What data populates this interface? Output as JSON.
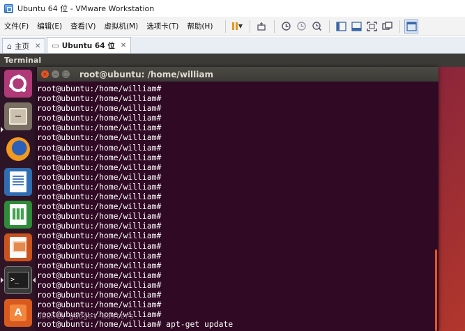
{
  "window": {
    "title": "Ubuntu 64 位 - VMware Workstation"
  },
  "menubar": {
    "items": [
      "文件(F)",
      "编辑(E)",
      "查看(V)",
      "虚拟机(M)",
      "选项卡(T)",
      "帮助(H)"
    ]
  },
  "toolbar": {
    "icons": [
      "pause-icon",
      "send-keys-icon",
      "snapshot-icon",
      "revert-snapshot-icon",
      "manage-snapshots-icon",
      "show-library-icon",
      "thumbnail-bar-icon",
      "fullscreen-icon",
      "unity-icon",
      "console-view-icon"
    ]
  },
  "tabs": [
    {
      "label": "主页",
      "icon": "home-icon",
      "active": false
    },
    {
      "label": "Ubuntu 64 位",
      "icon": "vm-icon",
      "active": true
    }
  ],
  "ubuntu": {
    "topbar_title": "Terminal",
    "launcher": [
      "dash-icon",
      "files-icon",
      "firefox-icon",
      "writer-icon",
      "calc-icon",
      "impress-icon",
      "terminal-icon",
      "software-icon"
    ],
    "accent": "#e95420",
    "terminal_bg": "#300a24"
  },
  "terminal": {
    "title": "root@ubuntu: /home/william",
    "lines": [
      "root@ubuntu:/home/william#",
      "root@ubuntu:/home/william#",
      "root@ubuntu:/home/william#",
      "root@ubuntu:/home/william#",
      "root@ubuntu:/home/william#",
      "root@ubuntu:/home/william#",
      "root@ubuntu:/home/william#",
      "root@ubuntu:/home/william#",
      "root@ubuntu:/home/william#",
      "root@ubuntu:/home/william#",
      "root@ubuntu:/home/william#",
      "root@ubuntu:/home/william#",
      "root@ubuntu:/home/william#",
      "root@ubuntu:/home/william#",
      "root@ubuntu:/home/william#",
      "root@ubuntu:/home/william#",
      "root@ubuntu:/home/william#",
      "root@ubuntu:/home/william#",
      "root@ubuntu:/home/william#",
      "root@ubuntu:/home/william#",
      "root@ubuntu:/home/william#",
      "root@ubuntu:/home/william#",
      "root@ubuntu:/home/william#",
      "root@ubuntu:/home/william#",
      "root@ubuntu:/home/william# apt-get update"
    ],
    "ghost_text": "ubuntu-gadget-masters"
  }
}
